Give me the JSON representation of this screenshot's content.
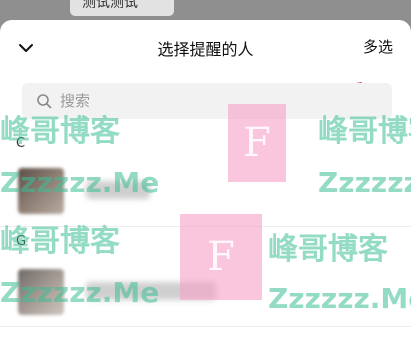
{
  "background_chip": {
    "text": "测试测试"
  },
  "header": {
    "title": "选择提醒的人",
    "multi_select_label": "多选"
  },
  "search": {
    "placeholder": "搜索"
  },
  "sections": [
    {
      "letter": "C"
    },
    {
      "letter": "G"
    }
  ],
  "watermark": {
    "site_name": "峰哥博客",
    "domain_text": "Zzzzzz.Me",
    "logo_letter": "F"
  },
  "colors": {
    "annotation_arrow": "#d42b2b",
    "watermark_green": "#3cbe96",
    "watermark_pink": "#f6a0c8"
  }
}
